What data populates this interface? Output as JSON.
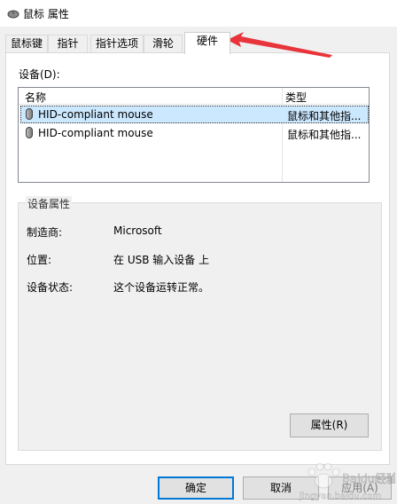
{
  "window": {
    "title": "鼠标 属性",
    "title_icon": "mouse-icon"
  },
  "tabs": [
    {
      "label": "鼠标键",
      "active": false
    },
    {
      "label": "指针",
      "active": false
    },
    {
      "label": "指针选项",
      "active": false
    },
    {
      "label": "滑轮",
      "active": false
    },
    {
      "label": "硬件",
      "active": true
    }
  ],
  "devices": {
    "label": "设备(D):",
    "columns": [
      "名称",
      "类型"
    ],
    "rows": [
      {
        "name": "HID-compliant mouse",
        "type": "鼠标和其他指...",
        "selected": true
      },
      {
        "name": "HID-compliant mouse",
        "type": "鼠标和其他指...",
        "selected": false
      }
    ]
  },
  "properties": {
    "group_title": "设备属性",
    "items": [
      {
        "label": "制造商:",
        "value": "Microsoft"
      },
      {
        "label": "位置:",
        "value": "在 USB 输入设备 上"
      },
      {
        "label": "设备状态:",
        "value": "这个设备运转正常。"
      }
    ],
    "button": "属性(R)"
  },
  "footer": {
    "ok": "确定",
    "cancel": "取消",
    "apply": "应用(A)"
  },
  "annotation": {
    "color": "#e8343a"
  },
  "watermark": {
    "text": "Baidu经验",
    "url_text": "jingyan.baidu.com"
  }
}
